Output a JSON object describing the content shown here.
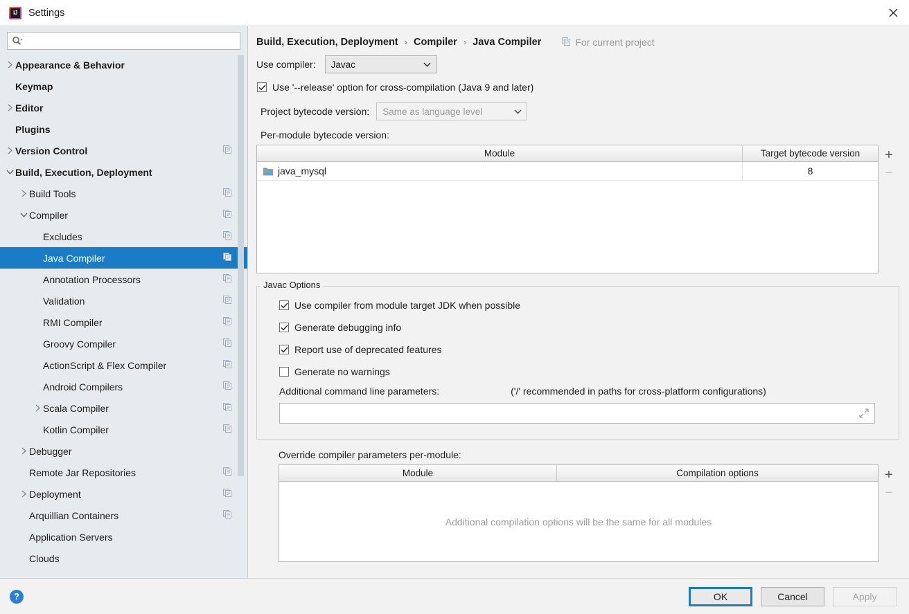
{
  "window": {
    "title": "Settings",
    "logo_icon": "intellij-idea-logo",
    "close_icon": "close-icon"
  },
  "search": {
    "value": "",
    "placeholder": "",
    "icon": "search-icon",
    "dropdown_icon": "chevron-down-icon"
  },
  "sidebar": {
    "items": [
      {
        "label": "Appearance & Behavior",
        "indent": 0,
        "arrow": "collapsed",
        "bold": true,
        "copy": false,
        "selected": false
      },
      {
        "label": "Keymap",
        "indent": 0,
        "arrow": "none",
        "bold": true,
        "copy": false,
        "selected": false
      },
      {
        "label": "Editor",
        "indent": 0,
        "arrow": "collapsed",
        "bold": true,
        "copy": false,
        "selected": false
      },
      {
        "label": "Plugins",
        "indent": 0,
        "arrow": "none",
        "bold": true,
        "copy": false,
        "selected": false
      },
      {
        "label": "Version Control",
        "indent": 0,
        "arrow": "collapsed",
        "bold": true,
        "copy": true,
        "selected": false
      },
      {
        "label": "Build, Execution, Deployment",
        "indent": 0,
        "arrow": "expanded",
        "bold": true,
        "copy": false,
        "selected": false
      },
      {
        "label": "Build Tools",
        "indent": 1,
        "arrow": "collapsed",
        "bold": false,
        "copy": true,
        "selected": false
      },
      {
        "label": "Compiler",
        "indent": 1,
        "arrow": "expanded",
        "bold": false,
        "copy": true,
        "selected": false
      },
      {
        "label": "Excludes",
        "indent": 2,
        "arrow": "none",
        "bold": false,
        "copy": true,
        "selected": false
      },
      {
        "label": "Java Compiler",
        "indent": 2,
        "arrow": "none",
        "bold": false,
        "copy": true,
        "selected": true
      },
      {
        "label": "Annotation Processors",
        "indent": 2,
        "arrow": "none",
        "bold": false,
        "copy": true,
        "selected": false
      },
      {
        "label": "Validation",
        "indent": 2,
        "arrow": "none",
        "bold": false,
        "copy": true,
        "selected": false
      },
      {
        "label": "RMI Compiler",
        "indent": 2,
        "arrow": "none",
        "bold": false,
        "copy": true,
        "selected": false
      },
      {
        "label": "Groovy Compiler",
        "indent": 2,
        "arrow": "none",
        "bold": false,
        "copy": true,
        "selected": false
      },
      {
        "label": "ActionScript & Flex Compiler",
        "indent": 2,
        "arrow": "none",
        "bold": false,
        "copy": true,
        "selected": false
      },
      {
        "label": "Android Compilers",
        "indent": 2,
        "arrow": "none",
        "bold": false,
        "copy": true,
        "selected": false
      },
      {
        "label": "Scala Compiler",
        "indent": 2,
        "arrow": "collapsed",
        "bold": false,
        "copy": true,
        "selected": false
      },
      {
        "label": "Kotlin Compiler",
        "indent": 2,
        "arrow": "none",
        "bold": false,
        "copy": true,
        "selected": false
      },
      {
        "label": "Debugger",
        "indent": 1,
        "arrow": "collapsed",
        "bold": false,
        "copy": false,
        "selected": false
      },
      {
        "label": "Remote Jar Repositories",
        "indent": 1,
        "arrow": "none",
        "bold": false,
        "copy": true,
        "selected": false
      },
      {
        "label": "Deployment",
        "indent": 1,
        "arrow": "collapsed",
        "bold": false,
        "copy": true,
        "selected": false
      },
      {
        "label": "Arquillian Containers",
        "indent": 1,
        "arrow": "none",
        "bold": false,
        "copy": true,
        "selected": false
      },
      {
        "label": "Application Servers",
        "indent": 1,
        "arrow": "none",
        "bold": false,
        "copy": false,
        "selected": false
      },
      {
        "label": "Clouds",
        "indent": 1,
        "arrow": "none",
        "bold": false,
        "copy": false,
        "selected": false
      }
    ]
  },
  "main": {
    "breadcrumb": [
      "Build, Execution, Deployment",
      "Compiler",
      "Java Compiler"
    ],
    "breadcrumb_separator": "›",
    "scope_label": "For current project",
    "scope_icon": "copy-icon",
    "use_compiler_label": "Use compiler:",
    "use_compiler_value": "Javac",
    "release_option_label": "Use '--release' option for cross-compilation (Java 9 and later)",
    "release_option_checked": true,
    "project_bytecode_label": "Project bytecode version:",
    "project_bytecode_value": "Same as language level",
    "project_bytecode_disabled": true,
    "per_module_label": "Per-module bytecode version:",
    "module_table": {
      "columns": [
        "Module",
        "Target bytecode version"
      ],
      "rows": [
        {
          "module": "java_mysql",
          "version": "8",
          "icon": "module-icon"
        }
      ],
      "add_label": "+",
      "remove_label": "−",
      "remove_disabled": true
    },
    "javac_group_title": "Javac Options",
    "javac_options": [
      {
        "label": "Use compiler from module target JDK when possible",
        "checked": true
      },
      {
        "label": "Generate debugging info",
        "checked": true
      },
      {
        "label": "Report use of deprecated features",
        "checked": true
      },
      {
        "label": "Generate no warnings",
        "checked": false
      }
    ],
    "additional_params_label": "Additional command line parameters:",
    "additional_params_hint": "('/' recommended in paths for cross-platform configurations)",
    "additional_params_value": "",
    "expand_icon": "expand-icon",
    "override_label": "Override compiler parameters per-module:",
    "override_table": {
      "columns": [
        "Module",
        "Compilation options"
      ],
      "empty_message": "Additional compilation options will be the same for all modules",
      "add_label": "+",
      "remove_label": "−",
      "remove_disabled": true
    }
  },
  "footer": {
    "help_label": "?",
    "ok_label": "OK",
    "cancel_label": "Cancel",
    "apply_label": "Apply",
    "apply_disabled": true
  },
  "colors": {
    "accent": "#1a7cc7",
    "sidebar_bg": "#e6ebef",
    "panel_bg": "#f2f2f2",
    "help_blue": "#2a7fd4"
  }
}
